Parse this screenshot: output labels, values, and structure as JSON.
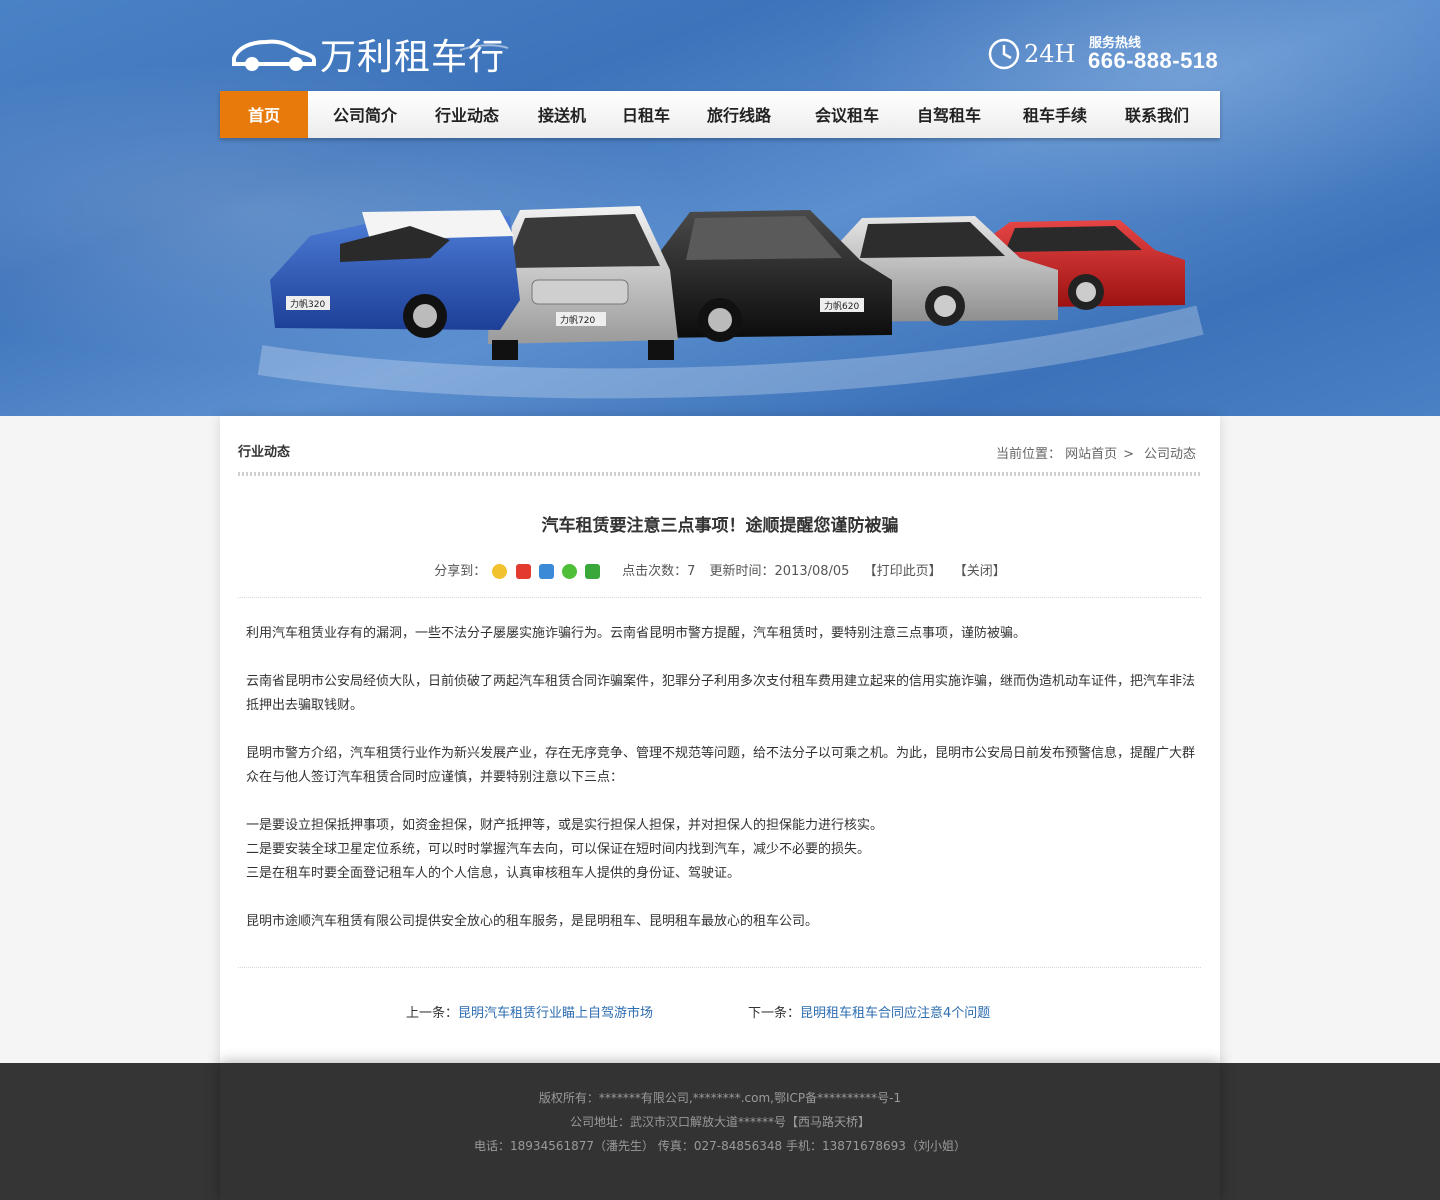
{
  "header": {
    "logo_text": "万利租车行",
    "hotline_label": "服务热线",
    "hotline_number": "666-888-518",
    "hotline_badge": "24H"
  },
  "nav": {
    "items": [
      {
        "label": "首页",
        "active": true
      },
      {
        "label": "公司简介"
      },
      {
        "label": "行业动态"
      },
      {
        "label": "接送机"
      },
      {
        "label": "日租车"
      },
      {
        "label": "旅行线路"
      },
      {
        "label": "会议租车"
      },
      {
        "label": "自驾租车"
      },
      {
        "label": "租车手续"
      },
      {
        "label": "联系我们"
      }
    ]
  },
  "banner": {
    "car_badges": [
      "力帆320",
      "力帆720",
      "力帆620"
    ]
  },
  "main": {
    "section_title": "行业动态",
    "breadcrumb": {
      "prefix": "当前位置：",
      "home": "网站首页",
      "separator": ">",
      "current": "公司动态"
    },
    "article": {
      "title": "汽车租赁要注意三点事项！途顺提醒您谨防被骗",
      "share_label": "分享到：",
      "hits": "点击次数：7",
      "updated": "更新时间：2013/08/05",
      "print": "【打印此页】",
      "close": "【关闭】",
      "paragraphs": [
        "利用汽车租赁业存有的漏洞，一些不法分子屡屡实施诈骗行为。云南省昆明市警方提醒，汽车租赁时，要特别注意三点事项，谨防被骗。",
        "云南省昆明市公安局经侦大队，日前侦破了两起汽车租赁合同诈骗案件，犯罪分子利用多次支付租车费用建立起来的信用实施诈骗，继而伪造机动车证件，把汽车非法抵押出去骗取钱财。",
        "昆明市警方介绍，汽车租赁行业作为新兴发展产业，存在无序竞争、管理不规范等问题，给不法分子以可乘之机。为此，昆明市公安局日前发布预警信息，提醒广大群众在与他人签订汽车租赁合同时应谨慎，并要特别注意以下三点："
      ],
      "points": [
        "一是要设立担保抵押事项，如资金担保，财产抵押等，或是实行担保人担保，并对担保人的担保能力进行核实。",
        "二是要安装全球卫星定位系统，可以时时掌握汽车去向，可以保证在短时间内找到汽车，减少不必要的损失。",
        "三是在租车时要全面登记租车人的个人信息，认真审核租车人提供的身份证、驾驶证。"
      ],
      "closing": "昆明市途顺汽车租赁有限公司提供安全放心的租车服务，是昆明租车、昆明租车最放心的租车公司。"
    },
    "prev": {
      "label": "上一条：",
      "title": "昆明汽车租赁行业瞄上自驾游市场"
    },
    "next": {
      "label": "下一条：",
      "title": "昆明租车租车合同应注意4个问题"
    }
  },
  "footer": {
    "copyright": "版权所有：*******有限公司,********.com,鄂ICP备**********号-1",
    "address": "公司地址：武汉市汉口解放大道******号【西马路天桥】",
    "contact": "电话：18934561877（潘先生） 传真：027-84856348 手机：13871678693（刘小姐）"
  },
  "colors": {
    "nav_active": "#e87a0c",
    "link": "#2c6cb0",
    "header_blue": "#4479c0",
    "footer_bg": "#333333"
  }
}
